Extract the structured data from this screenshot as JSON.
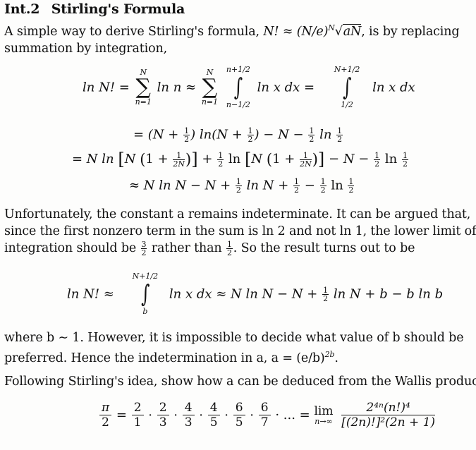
{
  "section": {
    "number": "Int.2",
    "title": "Stirling's Formula"
  },
  "intro": {
    "line1_a": "A simple way to derive Stirling's formula, ",
    "formula_lhs": "N!",
    "approx": "≈",
    "formula_rhs_base": "(N/e)",
    "formula_rhs_exp": "N",
    "sqrt_content": "aN",
    "line1_b": ", is by replacing",
    "line2": "summation by integration,"
  },
  "equation1": {
    "lhs": "ln N! =",
    "sum1_top": "N",
    "sum1_bottom": "n=1",
    "sum_symbol": "∑",
    "term1": "ln n ≈",
    "sum2_top": "N",
    "sum2_bottom": "n=1",
    "int1_top": "n+1/2",
    "int1_bottom": "n−1/2",
    "int_symbol": "∫",
    "integrand1": "ln x dx =",
    "int2_top": "N+1/2",
    "int2_bottom": "1/2",
    "integrand2": "ln x dx"
  },
  "equation2": {
    "line1": [
      "= (N + ",
      "1",
      "2",
      ") ln(N + ",
      "1",
      "2",
      ") − N − ",
      "1",
      "2",
      " ln ",
      "1",
      "2"
    ],
    "line2_parts": {
      "a": "= N ln",
      "b": "N",
      "c": "1 +",
      "frac_num": "1",
      "frac_den": "2N",
      "d": "+",
      "half_num": "1",
      "half_den": "2",
      "e": "ln",
      "f": "− N −",
      "g": "ln"
    },
    "line3_parts": {
      "a": "≈ N ln N − N +",
      "b": "ln N +",
      "c": "−",
      "d": "ln"
    }
  },
  "paragraph2": {
    "line1": "Unfortunately, the constant a remains indeterminate. It can be argued that,",
    "line2": "since the first nonzero term in the sum is ln 2 and not ln 1, the lower limit of",
    "line3_a": "integration should be ",
    "frac1_num": "3",
    "frac1_den": "2",
    "line3_b": " rather than ",
    "frac2_num": "1",
    "frac2_den": "2",
    "line3_c": ". So the result turns out to be"
  },
  "equation3": {
    "lhs": "ln N! ≈",
    "int_top": "N+1/2",
    "int_bottom": "b",
    "integrand": "ln x dx ≈ N ln N − N +",
    "half_num": "1",
    "half_den": "2",
    "rest": "ln N + b − b ln b"
  },
  "paragraph3": {
    "line1": "where b ∼ 1. However, it is impossible to decide what value of b should be",
    "line2_a": "preferred. Hence the indetermination in a, a = (e/b)",
    "line2_exp": "2b",
    "line2_b": "."
  },
  "paragraph4": {
    "line1": "Following Stirling's idea, show how a can be deduced from the Wallis product:"
  },
  "wallis": {
    "lhs_num": "π",
    "lhs_den": "2",
    "equals": "=",
    "factors": [
      {
        "num": "2",
        "den": "1"
      },
      {
        "num": "2",
        "den": "3"
      },
      {
        "num": "4",
        "den": "3"
      },
      {
        "num": "4",
        "den": "5"
      },
      {
        "num": "6",
        "den": "5"
      },
      {
        "num": "6",
        "den": "7"
      }
    ],
    "dots": "· ... =",
    "lim": "lim",
    "lim_sub": "n→∞",
    "rhs_num": "2⁴ⁿ(n!)⁴",
    "rhs_den": "[(2n)!]²(2n + 1)"
  }
}
